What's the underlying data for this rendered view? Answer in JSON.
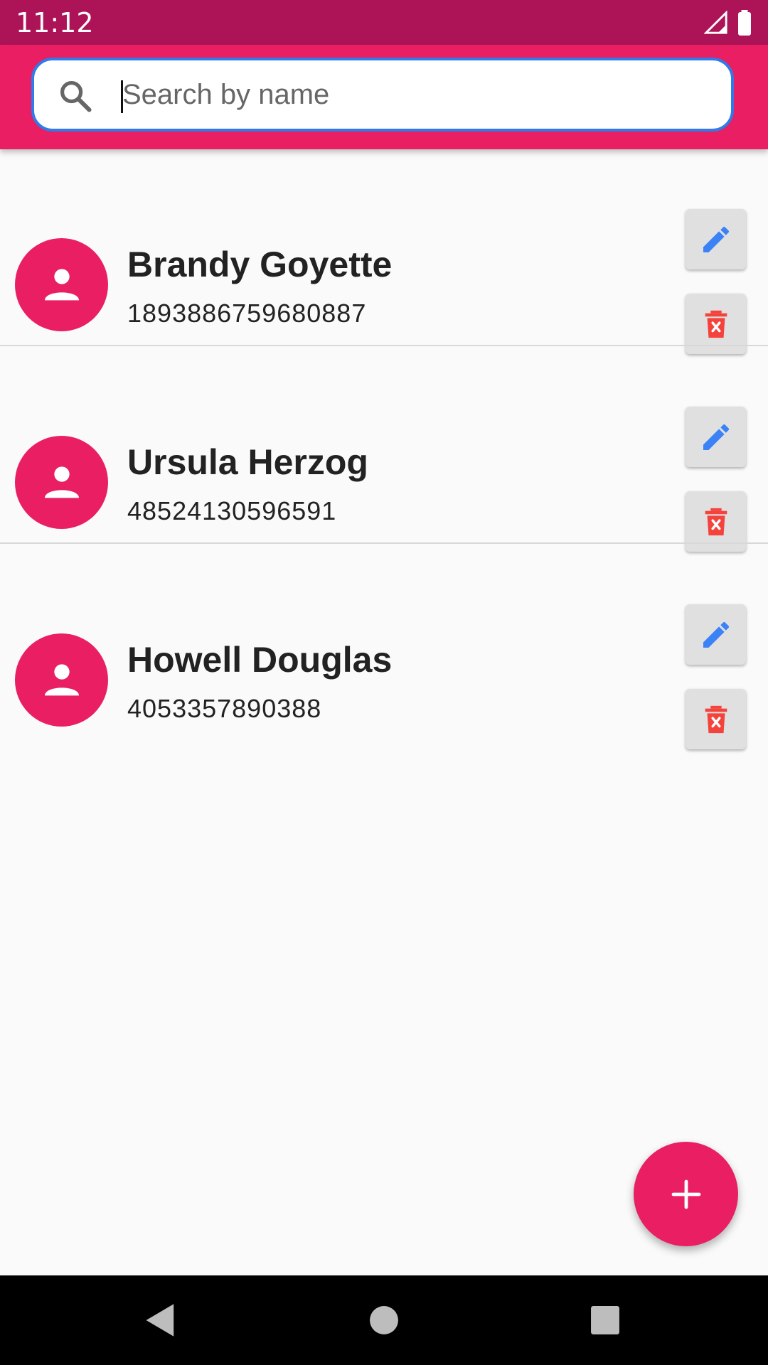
{
  "status_bar": {
    "time": "11:12",
    "icons": [
      "signal-icon",
      "battery-icon"
    ]
  },
  "search": {
    "placeholder": "Search by name",
    "value": "",
    "icon": "search-icon"
  },
  "contacts": [
    {
      "name": "Brandy Goyette",
      "phone": "1893886759680887"
    },
    {
      "name": "Ursula Herzog",
      "phone": "48524130596591"
    },
    {
      "name": "Howell Douglas",
      "phone": "4053357890388"
    }
  ],
  "actions": {
    "edit_icon": "pencil-icon",
    "delete_icon": "trash-icon",
    "add_icon": "plus-icon"
  },
  "nav": [
    "back-icon",
    "home-icon",
    "recents-icon"
  ],
  "colors": {
    "primary": "#e91e63",
    "primary_dark": "#ad1457",
    "focus": "#2f7be8",
    "edit": "#3b82f6",
    "delete": "#f4433c"
  }
}
